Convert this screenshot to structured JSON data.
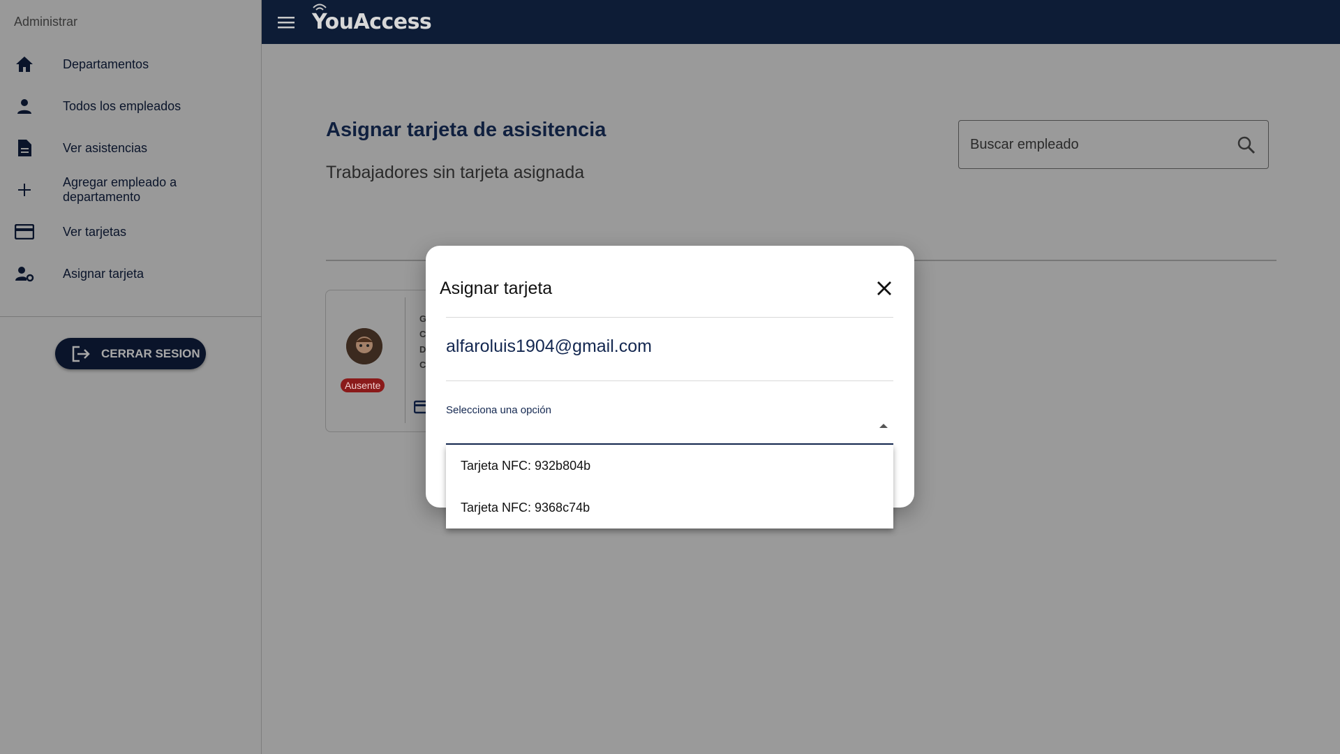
{
  "sidebar": {
    "title": "Administrar",
    "items": [
      {
        "label": "Departamentos",
        "icon": "home-icon"
      },
      {
        "label": "Todos los empleados",
        "icon": "person-icon"
      },
      {
        "label": "Ver asistencias",
        "icon": "document-icon"
      },
      {
        "label": "Agregar empleado a departamento",
        "icon": "plus-icon"
      },
      {
        "label": "Ver tarjetas",
        "icon": "credit-card-icon"
      },
      {
        "label": "Asignar tarjeta",
        "icon": "person-settings-icon"
      }
    ],
    "logout_label": "CERRAR SESION"
  },
  "topbar": {
    "brand": "YouAccess"
  },
  "main": {
    "title": "Asignar tarjeta de asisitencia",
    "subtitle": "Trabajadores sin tarjeta asignada",
    "search_placeholder": "Buscar empleado",
    "card": {
      "status": "Ausente",
      "letters": [
        "G",
        "C",
        "D",
        "C"
      ]
    }
  },
  "modal": {
    "title": "Asignar tarjeta",
    "email": "alfaroluis1904@gmail.com",
    "select_label": "Selecciona una opción",
    "options": [
      "Tarjeta NFC: 932b804b",
      "Tarjeta NFC: 9368c74b"
    ]
  },
  "colors": {
    "primary": "#0d1c36",
    "accent": "#132750",
    "badge": "#c62828"
  }
}
